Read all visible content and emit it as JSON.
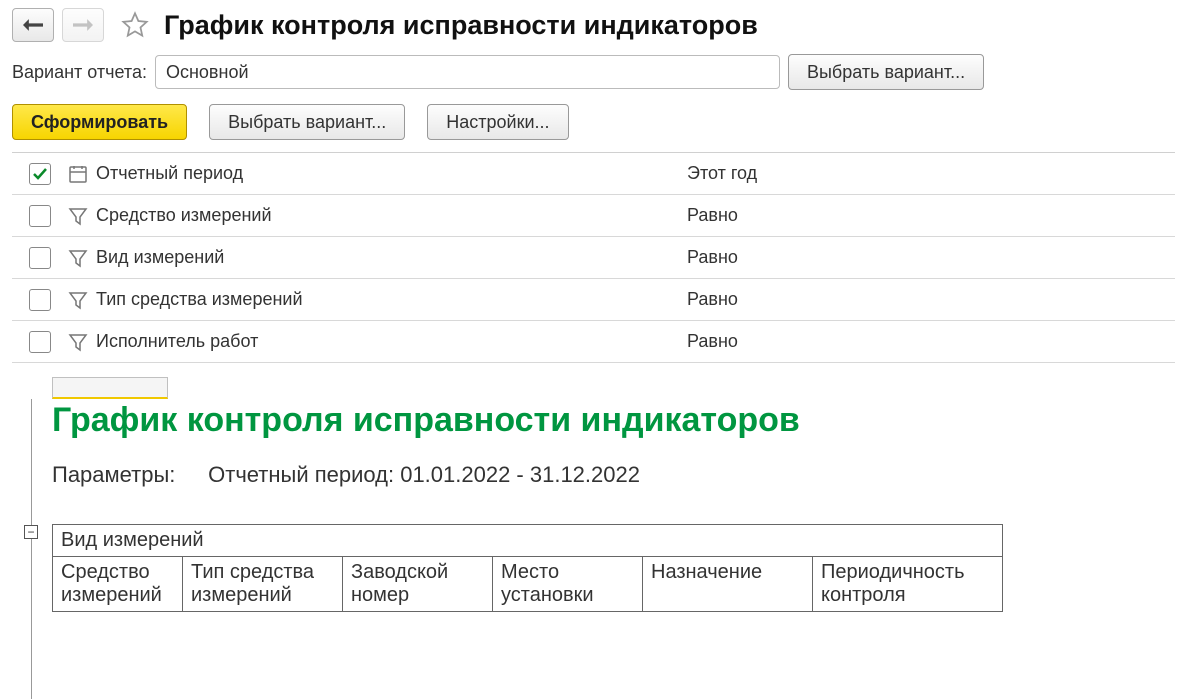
{
  "header": {
    "title": "График контроля исправности индикаторов"
  },
  "variant": {
    "label": "Вариант отчета:",
    "value": "Основной",
    "chooseButton": "Выбрать вариант..."
  },
  "toolbar": {
    "generate": "Сформировать",
    "chooseVariant": "Выбрать вариант...",
    "settings": "Настройки..."
  },
  "filters": [
    {
      "checked": true,
      "iconType": "calendar",
      "label": "Отчетный период",
      "value": "Этот год"
    },
    {
      "checked": false,
      "iconType": "filter",
      "label": "Средство измерений",
      "value": "Равно"
    },
    {
      "checked": false,
      "iconType": "filter",
      "label": "Вид измерений",
      "value": "Равно"
    },
    {
      "checked": false,
      "iconType": "filter",
      "label": "Тип средства измерений",
      "value": "Равно"
    },
    {
      "checked": false,
      "iconType": "filter",
      "label": "Исполнитель работ",
      "value": "Равно"
    }
  ],
  "report": {
    "title": "График контроля исправности индикаторов",
    "paramsLabel": "Параметры:",
    "paramsValue": "Отчетный период: 01.01.2022 - 31.12.2022",
    "collapseSymbol": "−",
    "groupHeader": "Вид измерений",
    "columns": [
      "Средство измерений",
      "Тип средства измерений",
      "Заводской номер",
      "Место установки",
      "Назначение",
      "Периодичность контроля"
    ]
  }
}
